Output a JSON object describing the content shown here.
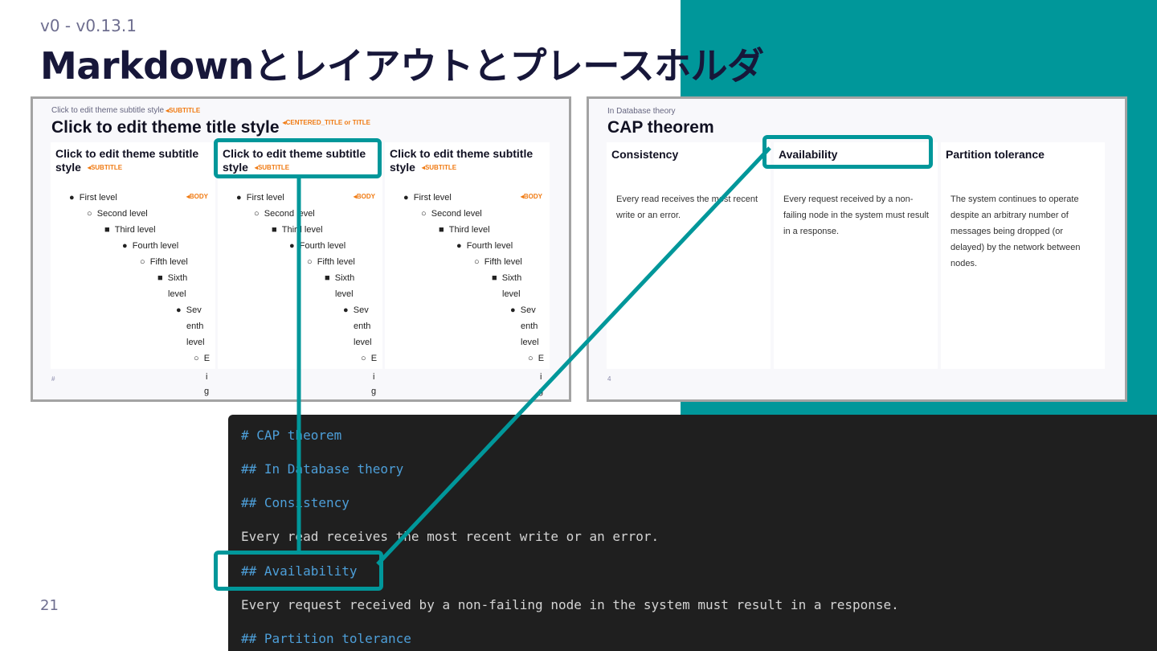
{
  "header": {
    "version": "v0 - v0.13.1",
    "title": "Markdownとレイアウトとプレースホルダ",
    "page_number": "21"
  },
  "left_thumb": {
    "subtitle": "Click to edit theme subtitle style",
    "subtitle_tag": "◂SUBTITLE",
    "title": "Click to edit theme title style",
    "title_tag": "◂CENTERED_TITLE or TITLE",
    "column_heading": "Click to edit theme subtitle style",
    "column_tag": "◂SUBTITLE",
    "body_tag": "◂BODY",
    "levels": {
      "l1": "First level",
      "l2": "Second level",
      "l3": "Third level",
      "l4": "Fourth level",
      "l5": "Fifth level",
      "l6a": "Sixth",
      "l6b": "level",
      "l7a": "Sev",
      "l7b": "enth",
      "l7c": "level",
      "l8a": "E",
      "l8b": "i",
      "l8c": "g"
    },
    "page": "#"
  },
  "right_thumb": {
    "subtitle": "In Database theory",
    "title": "CAP theorem",
    "columns": [
      {
        "heading": "Consistency",
        "body": "Every read receives the most recent write or an error."
      },
      {
        "heading": "Availability",
        "body": "Every request received by a non-failing node in the system must result in a response."
      },
      {
        "heading": "Partition tolerance",
        "body": "The system continues to operate despite an arbitrary number of messages being dropped (or delayed) by the network between nodes."
      }
    ],
    "page": "4"
  },
  "code": {
    "lines": [
      "# CAP theorem",
      "## In Database theory",
      "## Consistency",
      "Every read receives the most recent write or an error.",
      "## Availability",
      "Every request received by a non-failing node in the system must result in a response.",
      "## Partition tolerance"
    ]
  },
  "colors": {
    "accent": "#00979a",
    "title": "#17173a",
    "tag": "#f07a12",
    "code_bg": "#1f1f1f",
    "code_heading": "#4d9fd9"
  }
}
